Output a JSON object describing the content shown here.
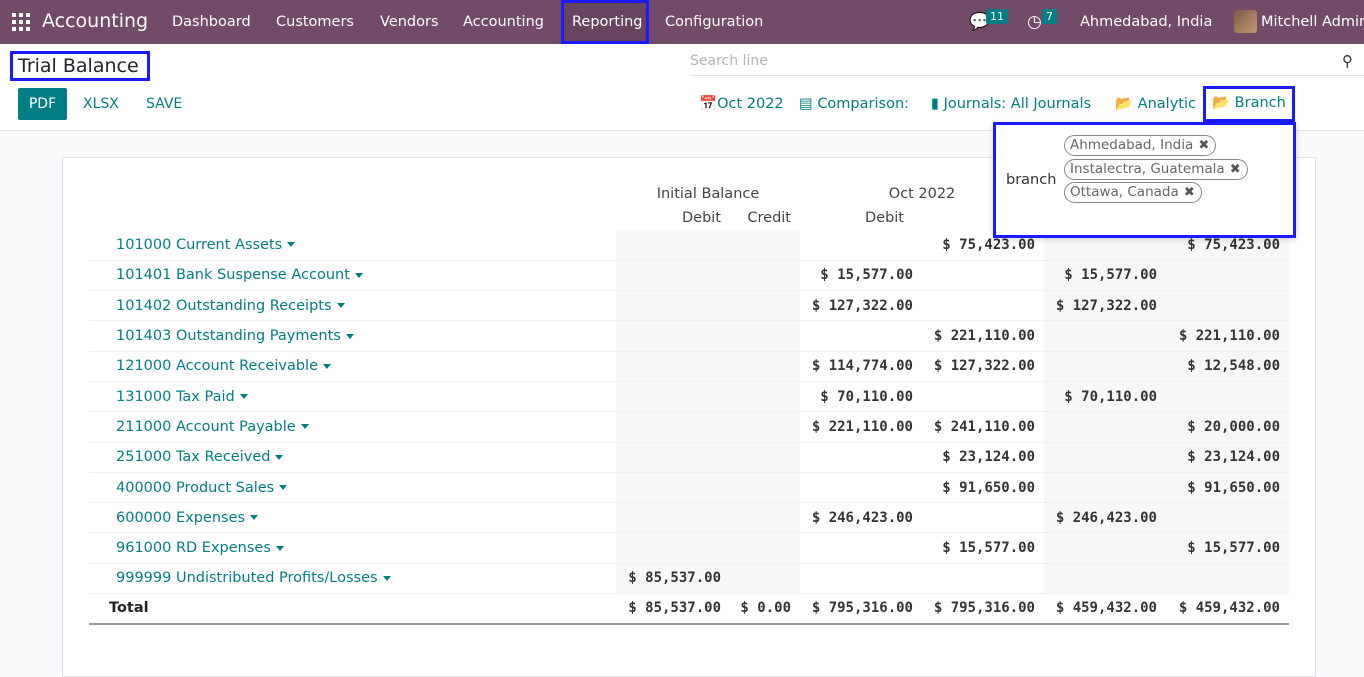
{
  "app": {
    "name": "Accounting",
    "menu": [
      "Dashboard",
      "Customers",
      "Vendors",
      "Accounting",
      "Reporting",
      "Configuration"
    ],
    "messages_count": "11",
    "activities_count": "7",
    "company": "Ahmedabad, India",
    "user": "Mitchell Admin"
  },
  "page": {
    "title": "Trial Balance",
    "search_placeholder": "Search line",
    "buttons": {
      "pdf": "PDF",
      "xlsx": "XLSX",
      "save": "SAVE"
    },
    "filters": {
      "date": "Oct 2022",
      "comparison": "Comparison:",
      "journals": "Journals: All Journals",
      "analytic": "Analytic",
      "branch": "Branch"
    }
  },
  "branch_dropdown": {
    "label": "branch",
    "tags": [
      "Ahmedabad, India",
      "Instalectra, Guatemala",
      "Ottawa, Canada"
    ]
  },
  "table": {
    "group_headers": {
      "initial": "Initial Balance",
      "period": "Oct 2022"
    },
    "sub_headers": {
      "debit": "Debit",
      "credit": "Credit"
    },
    "rows": [
      {
        "name": "101000 Current Assets",
        "cols": [
          "",
          "",
          "",
          "$ 75,423.00",
          "",
          "$ 75,423.00"
        ]
      },
      {
        "name": "101401 Bank Suspense Account",
        "cols": [
          "",
          "",
          "$ 15,577.00",
          "",
          "$ 15,577.00",
          ""
        ]
      },
      {
        "name": "101402 Outstanding Receipts",
        "cols": [
          "",
          "",
          "$ 127,322.00",
          "",
          "$ 127,322.00",
          ""
        ]
      },
      {
        "name": "101403 Outstanding Payments",
        "cols": [
          "",
          "",
          "",
          "$ 221,110.00",
          "",
          "$ 221,110.00"
        ]
      },
      {
        "name": "121000 Account Receivable",
        "cols": [
          "",
          "",
          "$ 114,774.00",
          "$ 127,322.00",
          "",
          "$ 12,548.00"
        ]
      },
      {
        "name": "131000 Tax Paid",
        "cols": [
          "",
          "",
          "$ 70,110.00",
          "",
          "$ 70,110.00",
          ""
        ]
      },
      {
        "name": "211000 Account Payable",
        "cols": [
          "",
          "",
          "$ 221,110.00",
          "$ 241,110.00",
          "",
          "$ 20,000.00"
        ]
      },
      {
        "name": "251000 Tax Received",
        "cols": [
          "",
          "",
          "",
          "$ 23,124.00",
          "",
          "$ 23,124.00"
        ]
      },
      {
        "name": "400000 Product Sales",
        "cols": [
          "",
          "",
          "",
          "$ 91,650.00",
          "",
          "$ 91,650.00"
        ]
      },
      {
        "name": "600000 Expenses",
        "cols": [
          "",
          "",
          "$ 246,423.00",
          "",
          "$ 246,423.00",
          ""
        ]
      },
      {
        "name": "961000 RD Expenses",
        "cols": [
          "",
          "",
          "",
          "$ 15,577.00",
          "",
          "$ 15,577.00"
        ]
      },
      {
        "name": "999999 Undistributed Profits/Losses",
        "cols": [
          "$ 85,537.00",
          "",
          "",
          "",
          "",
          ""
        ]
      }
    ],
    "total": {
      "label": "Total",
      "cols": [
        "$ 85,537.00",
        "$ 0.00",
        "$ 795,316.00",
        "$ 795,316.00",
        "$ 459,432.00",
        "$ 459,432.00"
      ]
    }
  }
}
